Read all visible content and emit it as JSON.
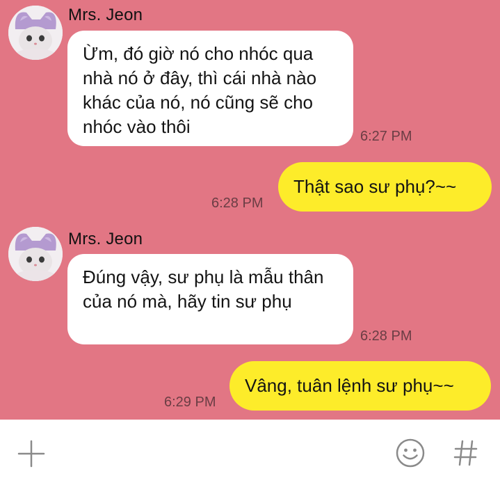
{
  "chat": {
    "background": "#e27684",
    "messages": [
      {
        "direction": "incoming",
        "sender": "Mrs. Jeon",
        "text": "Ừm, đó giờ nó cho nhóc qua nhà nó ở đây, thì cái nhà nào khác của nó, nó cũng sẽ cho nhóc vào thôi",
        "time": "6:27 PM"
      },
      {
        "direction": "outgoing",
        "text": "Thật sao sư phụ?~~",
        "time": "6:28 PM"
      },
      {
        "direction": "incoming",
        "sender": "Mrs. Jeon",
        "text": "Đúng vậy, sư phụ là mẫu thân của nó mà, hãy tin sư phụ",
        "time": "6:28 PM"
      },
      {
        "direction": "outgoing",
        "text": "Vâng, tuân lệnh sư phụ~~",
        "time": "6:29 PM"
      }
    ]
  },
  "composer": {
    "add_icon": "plus-icon",
    "emoji_icon": "smiley-icon",
    "hashtag_icon": "hashtag-icon"
  },
  "colors": {
    "incoming_bubble": "#ffffff",
    "outgoing_bubble": "#fdec2a"
  }
}
